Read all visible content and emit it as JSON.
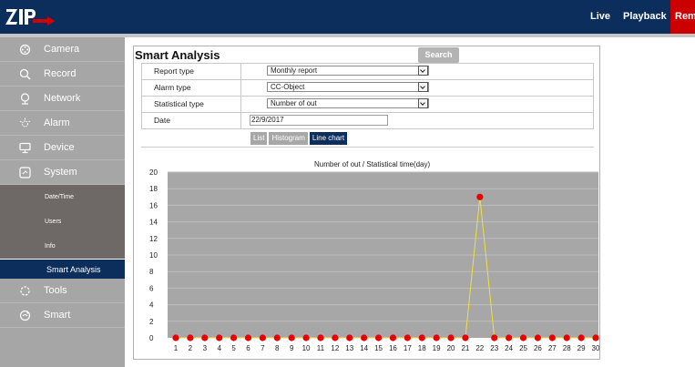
{
  "header": {
    "nav": [
      "Live",
      "Playback",
      "Rem"
    ]
  },
  "sidebar": {
    "items": [
      {
        "label": "Camera",
        "icon": "camera-icon"
      },
      {
        "label": "Record",
        "icon": "search-icon"
      },
      {
        "label": "Network",
        "icon": "network-icon"
      },
      {
        "label": "Alarm",
        "icon": "alarm-icon"
      },
      {
        "label": "Device",
        "icon": "device-icon"
      },
      {
        "label": "System",
        "icon": "system-icon"
      }
    ],
    "sub_items": [
      "Date/Time",
      "Users",
      "Info",
      "Smart Analysis"
    ],
    "bottom_items": [
      {
        "label": "Tools",
        "icon": "tools-icon"
      },
      {
        "label": "Smart",
        "icon": "smart-icon"
      }
    ]
  },
  "panel": {
    "title": "Smart Analysis",
    "search_label": "Search",
    "rows": [
      {
        "label": "Report type",
        "value": "Monthly report"
      },
      {
        "label": "Alarm type",
        "value": "CC-Object"
      },
      {
        "label": "Statistical type",
        "value": "Number of out"
      }
    ],
    "date": {
      "label": "Date",
      "value": "22/9/2017"
    },
    "tabs": [
      "List",
      "Histogram",
      "Line chart"
    ],
    "active_tab": "Line chart"
  },
  "chart_data": {
    "type": "line",
    "title": "Number of out / Statistical time(day)",
    "x": [
      1,
      2,
      3,
      4,
      5,
      6,
      7,
      8,
      9,
      10,
      11,
      12,
      13,
      14,
      15,
      16,
      17,
      18,
      19,
      20,
      21,
      22,
      23,
      24,
      25,
      26,
      27,
      28,
      29,
      30
    ],
    "series": [
      {
        "values": [
          0,
          0,
          0,
          0,
          0,
          0,
          0,
          0,
          0,
          0,
          0,
          0,
          0,
          0,
          0,
          0,
          0,
          0,
          0,
          0,
          0,
          17,
          0,
          0,
          0,
          0,
          0,
          0,
          0,
          0
        ]
      }
    ],
    "yticks": [
      0,
      2,
      4,
      6,
      8,
      10,
      12,
      14,
      16,
      18,
      20
    ],
    "ylim": [
      0,
      20
    ],
    "grid": true,
    "colors": {
      "plot_bg": "#a7a7a7",
      "grid": "#bdbdbd",
      "line": "#f0e040",
      "marker": "#e80000"
    }
  }
}
